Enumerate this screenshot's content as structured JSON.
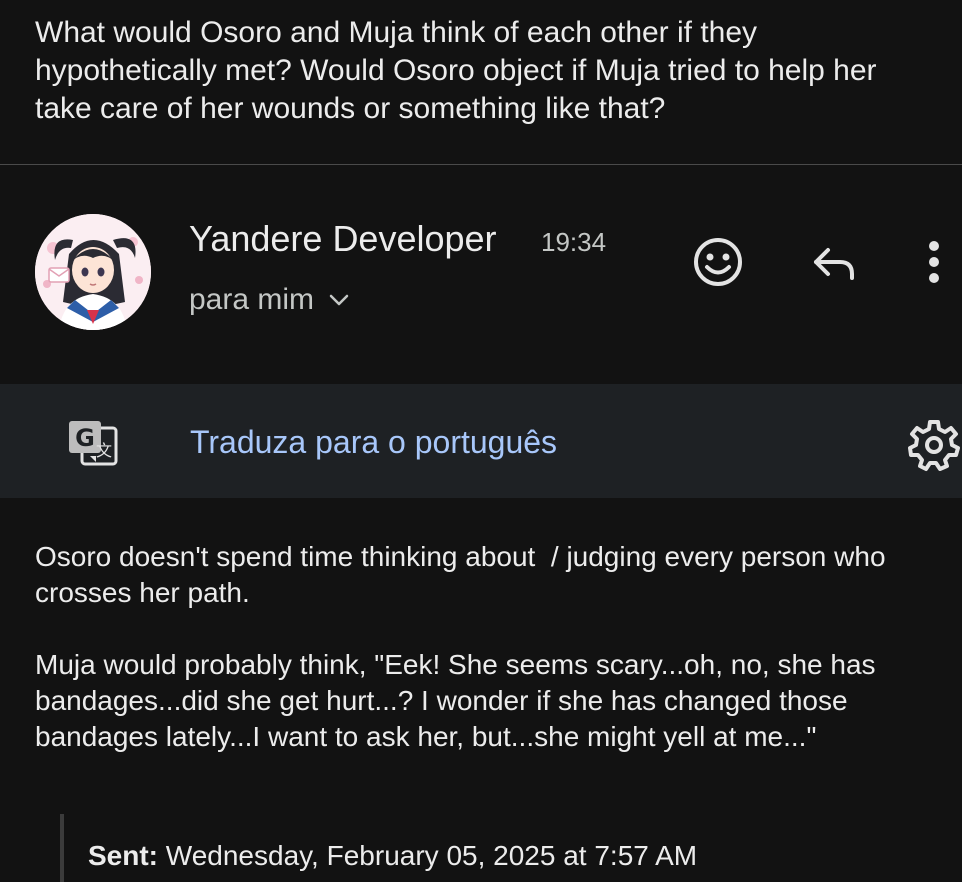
{
  "question": {
    "text": "What would Osoro and Muja think of each other if they hypothetically met? Would Osoro object if Muja tried to help her take care of her wounds or something like that?"
  },
  "header": {
    "sender_name": "Yandere Developer",
    "time": "19:34",
    "recipient": "para mim"
  },
  "translate_bar": {
    "label": "Traduza para o português"
  },
  "body": {
    "paragraph1": "Osoro doesn't spend time thinking about  / judging every person who crosses her path.",
    "paragraph2": "Muja would probably think, \"Eek! She seems scary...oh, no, she has bandages...did she get hurt...? I wonder if she has changed those bandages lately...I want to ask her, but...she might yell at me...\"",
    "sent_label": "Sent:",
    "sent_value": "Wednesday, February 05, 2025 at 7:57 AM"
  },
  "icons": {
    "emoji": "add-reaction-icon",
    "reply": "reply-icon",
    "more": "more-vert-icon",
    "translate": "google-translate-icon",
    "settings": "gear-icon",
    "chevron": "chevron-down-icon"
  },
  "colors": {
    "background": "#121212",
    "translate_bar": "#1e2124",
    "link": "#a8c7fa",
    "text": "#ececec",
    "muted": "#c4c7c5"
  }
}
